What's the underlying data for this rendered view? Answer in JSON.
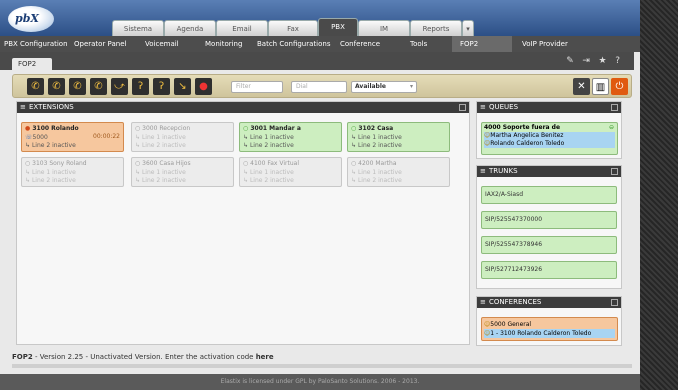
{
  "logo": {
    "text": "pbX"
  },
  "main_tabs": [
    "Sistema",
    "Agenda",
    "Email",
    "Fax",
    "PBX",
    "IM",
    "Reports"
  ],
  "sub_menu": [
    "PBX Configuration",
    "Operator Panel",
    "Voicemail",
    "Monitoring",
    "Batch Configurations",
    "Conference",
    "Tools",
    "FOP2",
    "VoIP Provider"
  ],
  "page_tab": "FOP2",
  "toolbar": {
    "filter_placeholder": "Filter",
    "dial_placeholder": "Dial",
    "presence_value": "Available"
  },
  "extensions": {
    "title": "EXTENSIONS",
    "items": [
      {
        "name": "3100 Rolando",
        "l1": "5000",
        "l2": "Line 2 inactive",
        "timer": "00:00:22",
        "state": "busy"
      },
      {
        "name": "3000 Recepcion",
        "l1": "Line 1 inactive",
        "l2": "Line 2 inactive",
        "state": "off"
      },
      {
        "name": "3001 Mandar a",
        "l1": "Line 1 inactive",
        "l2": "Line 2 inactive",
        "state": "free"
      },
      {
        "name": "3102 Casa",
        "l1": "Line 1 inactive",
        "l2": "Line 2 inactive",
        "state": "free"
      },
      {
        "name": "3103 Sony Roland",
        "l1": "Line 1 inactive",
        "l2": "Line 2 inactive",
        "state": "off"
      },
      {
        "name": "3600 Casa Hijos",
        "l1": "Line 1 inactive",
        "l2": "Line 2 inactive",
        "state": "off"
      },
      {
        "name": "4100 Fax Virtual",
        "l1": "Line 1 inactive",
        "l2": "Line 2 inactive",
        "state": "off"
      },
      {
        "name": "4200 Martha",
        "l1": "Line 1 inactive",
        "l2": "Line 2 inactive",
        "state": "off"
      }
    ]
  },
  "queues": {
    "title": "QUEUES",
    "queue_name": "4000 Soporte fuera de",
    "members": [
      "Martha Angelica Benitez",
      "Rolando Calderon Toledo"
    ]
  },
  "trunks": {
    "title": "TRUNKS",
    "items": [
      "IAX2/A-Siasd",
      "SIP/525547370000",
      "SIP/525547378946",
      "SIP/527712473926"
    ]
  },
  "conferences": {
    "title": "CONFERENCES",
    "room": "5000 General",
    "member": "1 - 3100 Rolando Calderon Toledo"
  },
  "status": {
    "prefix": "FOP2",
    "text": " - Version 2.25 - Unactivated Version. Enter the activation code ",
    "link": "here"
  },
  "footer": "Elastix is licensed under GPL by PaloSanto Solutions. 2006 - 2013.",
  "colors": {
    "busy": "#f6c79e",
    "free": "#cdeec0",
    "inactive": "#ececec",
    "queue_member": "#a8d4f2"
  }
}
